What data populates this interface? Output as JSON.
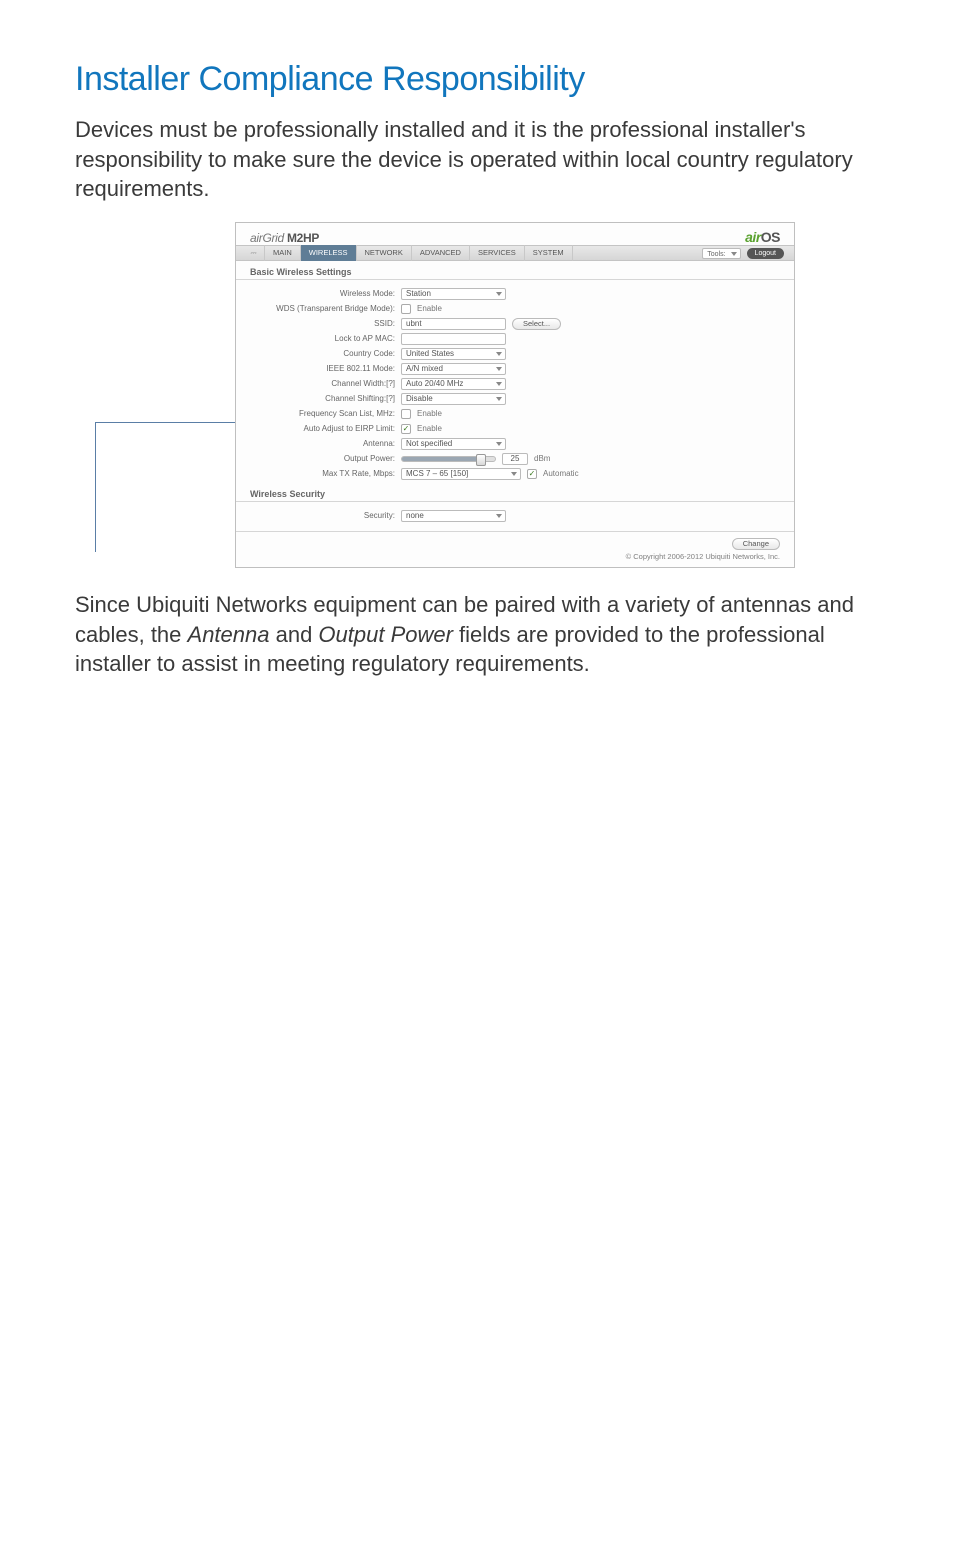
{
  "heading": "Installer Compliance Responsibility",
  "intro": "Devices must be professionally installed and it is the professional installer's responsibility to make sure the device is operated within local country regulatory requirements.",
  "outro_parts": {
    "p1": "Since Ubiquiti Networks equipment can be paired with a variety of antennas and cables, the ",
    "i1": "Antenna",
    "p2": " and ",
    "i2": "Output Power",
    "p3": " fields are provided to the professional installer to assist in meeting regulatory requirements."
  },
  "shot": {
    "brand_left_prefix": "air",
    "brand_left_mid": "Grid",
    "brand_left_model": " M2HP",
    "brand_right_prefix": "air",
    "brand_right_os": "OS",
    "tabs": {
      "icon": "⎓",
      "main": "MAIN",
      "wireless": "WIRELESS",
      "network": "NETWORK",
      "advanced": "ADVANCED",
      "services": "SERVICES",
      "system": "SYSTEM"
    },
    "tools_label": "Tools:",
    "logout": "Logout",
    "section_basic": "Basic Wireless Settings",
    "section_security": "Wireless Security",
    "fields": {
      "wireless_mode": {
        "label": "Wireless Mode:",
        "value": "Station"
      },
      "wds": {
        "label": "WDS (Transparent Bridge Mode):",
        "text": "Enable"
      },
      "ssid": {
        "label": "SSID:",
        "value": "ubnt",
        "button": "Select..."
      },
      "lock_mac": {
        "label": "Lock to AP MAC:",
        "value": ""
      },
      "country": {
        "label": "Country Code:",
        "value": "United States"
      },
      "ieee": {
        "label": "IEEE 802.11 Mode:",
        "value": "A/N mixed"
      },
      "ch_width": {
        "label": "Channel Width:[?]",
        "value": "Auto 20/40 MHz"
      },
      "ch_shift": {
        "label": "Channel Shifting:[?]",
        "value": "Disable"
      },
      "freq_scan": {
        "label": "Frequency Scan List, MHz:",
        "text": "Enable"
      },
      "eirp": {
        "label": "Auto Adjust to EIRP Limit:",
        "text": "Enable",
        "checked": true
      },
      "antenna": {
        "label": "Antenna:",
        "value": "Not specified"
      },
      "output_power": {
        "label": "Output Power:",
        "value": "25",
        "unit": "dBm"
      },
      "max_tx": {
        "label": "Max TX Rate, Mbps:",
        "value": "MCS 7 – 65 [150]",
        "auto_text": "Automatic",
        "auto_checked": true
      },
      "security": {
        "label": "Security:",
        "value": "none"
      }
    },
    "change_btn": "Change",
    "copyright": "© Copyright 2006-2012 Ubiquiti Networks, Inc."
  }
}
